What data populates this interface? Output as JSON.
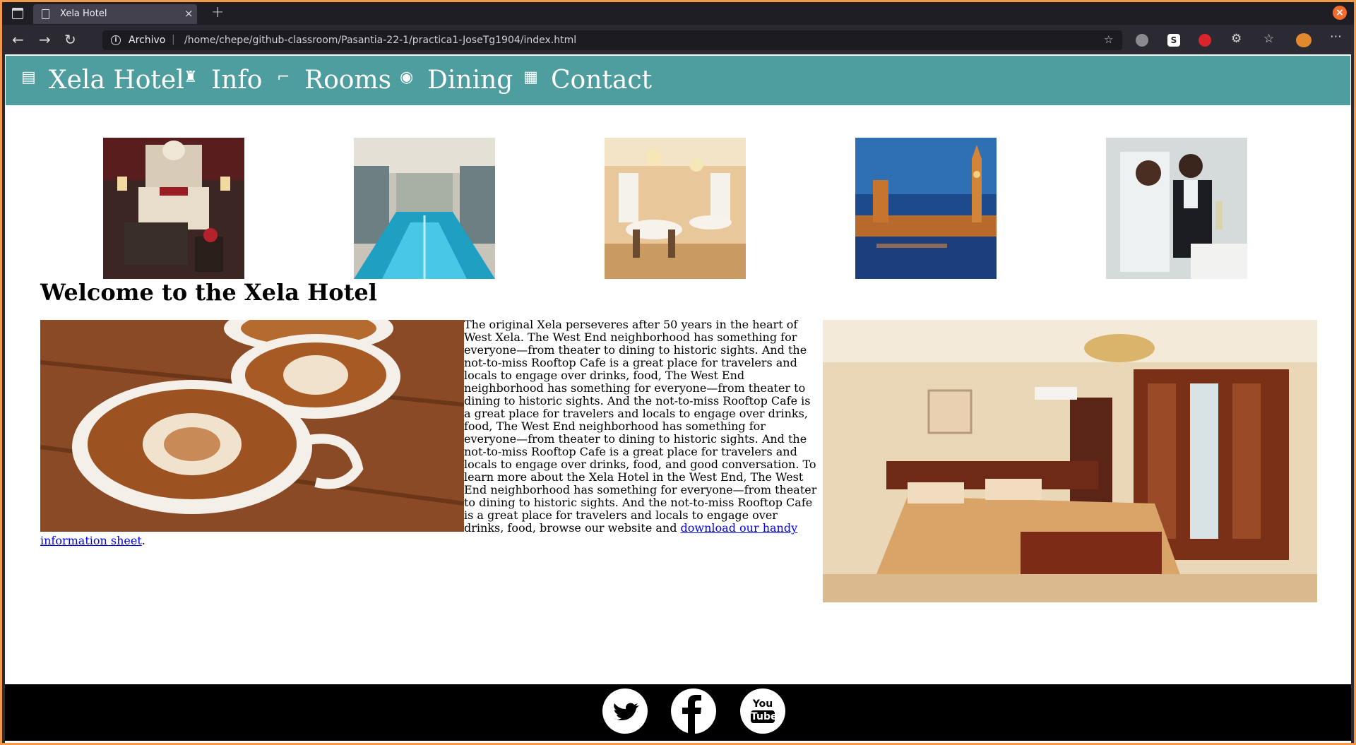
{
  "browser": {
    "tab_title": "Xela Hotel",
    "tab_close_glyph": "×",
    "new_tab_glyph": "+",
    "window_close_glyph": "×",
    "url_scheme": "Archivo",
    "url_path": "/home/chepe/github-classroom/Pasantia-22-1/practica1-JoseTg1904/index.html",
    "icons": [
      "sidebar-icon",
      "document-icon",
      "back-arrow-icon",
      "forward-arrow-icon",
      "reload-icon",
      "info-icon",
      "bookmark-star-icon",
      "extension-icons",
      "favorites-icon",
      "profile-avatar",
      "menu-icon"
    ],
    "back_glyph": "←",
    "forward_glyph": "→",
    "reload_glyph": "↻",
    "info_glyph": "i",
    "bookmark_glyph": "☆",
    "puzzle_glyph": "⚙",
    "favorites_glyph": "☆",
    "menu_glyph": "⋯"
  },
  "site_nav": {
    "items": [
      {
        "label": "Xela Hotel",
        "icon": "hotel-icon",
        "glyph": "▤"
      },
      {
        "label": "Info",
        "icon": "bigben-icon",
        "glyph": "♜"
      },
      {
        "label": "Rooms",
        "icon": "bed-icon",
        "glyph": "⌐"
      },
      {
        "label": "Dining",
        "icon": "dining-icon",
        "glyph": "◉"
      },
      {
        "label": "Contact",
        "icon": "calendar-icon",
        "glyph": "▦"
      }
    ]
  },
  "gallery": {
    "images": [
      "hotel-bedroom-photo",
      "indoor-pool-photo",
      "dining-hall-photo",
      "london-westminster-photo",
      "wedding-couple-photo"
    ]
  },
  "main": {
    "heading": "Welcome to the Xela Hotel",
    "paragraph_text": "The original Xela perseveres after 50 years in the heart of West Xela. The West End neighborhood has something for everyone—from theater to dining to historic sights. And the not-to-miss Rooftop Cafe is a great place for travelers and locals to engage over drinks, food, The West End neighborhood has something for everyone—from theater to dining to historic sights. And the not-to-miss Rooftop Cafe is a great place for travelers and locals to engage over drinks, food, The West End neighborhood has something for everyone—from theater to dining to historic sights. And the not-to-miss Rooftop Cafe is a great place for travelers and locals to engage over drinks, food, and good conversation.   To learn more about the Xela Hotel in the West End, The West End neighborhood has something for everyone—from theater to dining to historic sights. And the not-to-miss Rooftop Cafe is a great place for travelers and locals to engage over drinks, food, browse our website and ",
    "link_text": "download our handy information sheet",
    "trailing": ".",
    "images": [
      "latte-art-cups-photo",
      "hotel-room-photo"
    ]
  },
  "footer": {
    "social": [
      {
        "name": "twitter-icon",
        "label": "Twitter"
      },
      {
        "name": "facebook-icon",
        "label": "f"
      },
      {
        "name": "youtube-icon",
        "label": "You",
        "label2": "Tube"
      }
    ]
  },
  "colors": {
    "nav_bg": "#4e9d9f",
    "footer_bg": "#000000",
    "link": "#0000ee",
    "browser_accent": "#f29a4a"
  }
}
